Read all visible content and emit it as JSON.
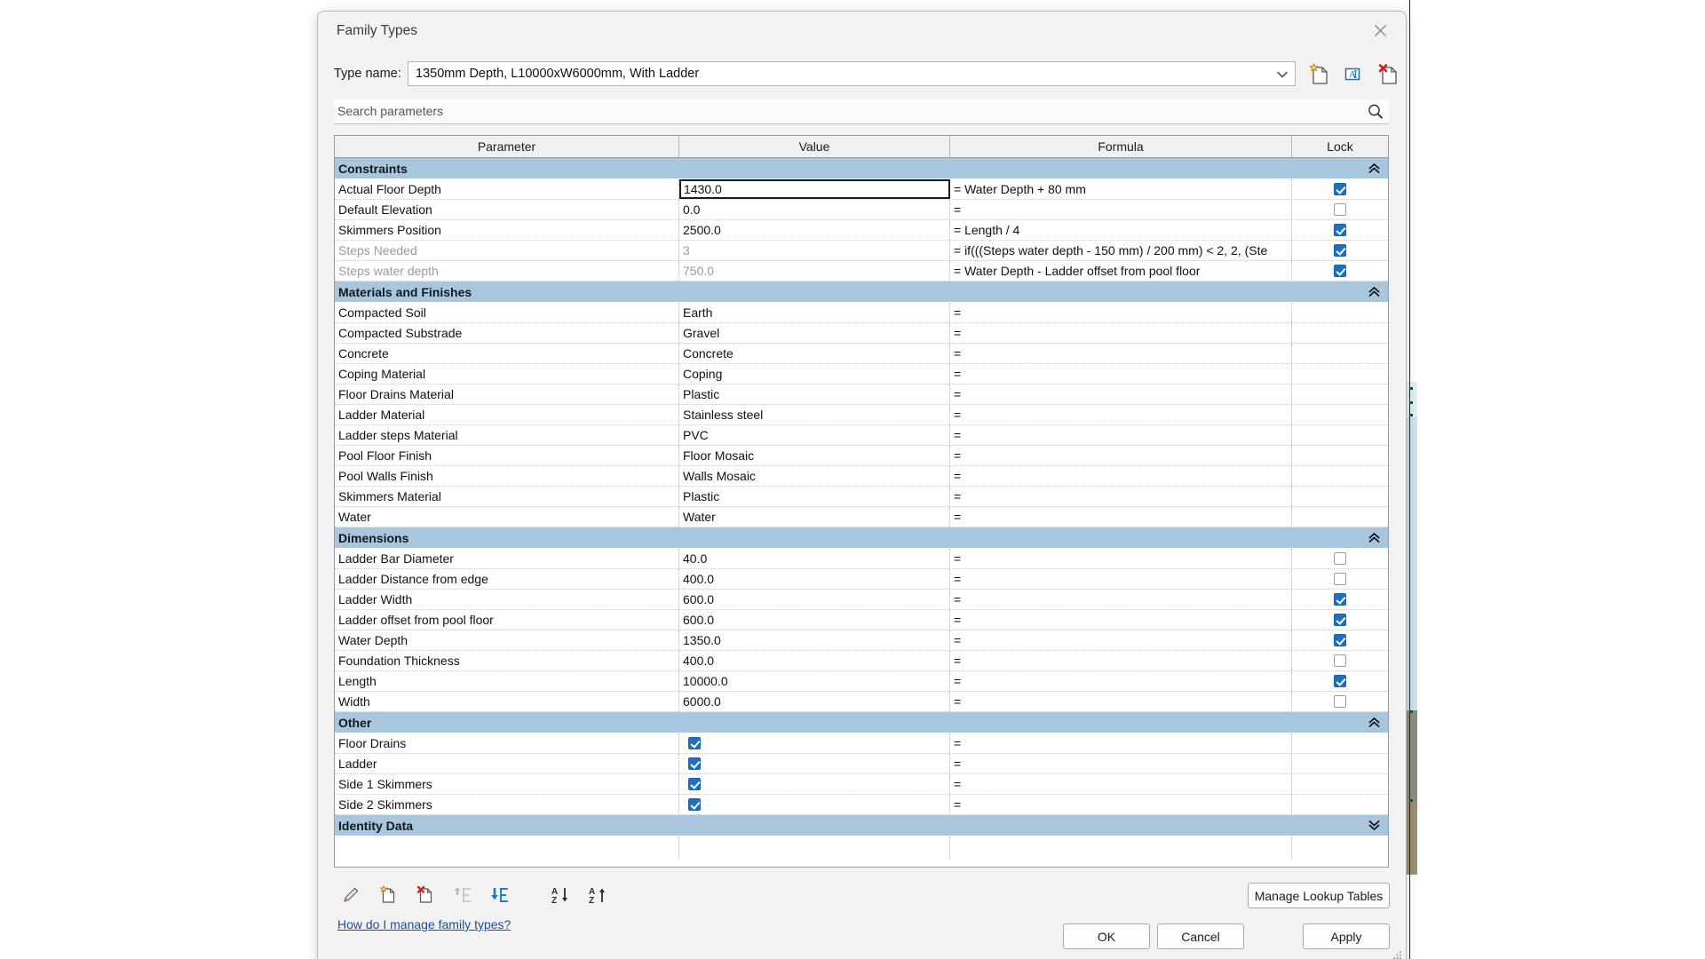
{
  "window": {
    "title": "Family Types",
    "close_icon": "close-icon"
  },
  "type_name": {
    "label": "Type name:",
    "value": "1350mm Depth, L10000xW6000mm, With Ladder",
    "dropdown_icon": "chevron-down-icon",
    "actions": [
      {
        "name": "new-type-icon",
        "tooltip": "New Type"
      },
      {
        "name": "rename-type-icon",
        "tooltip": "Rename"
      },
      {
        "name": "delete-type-icon",
        "tooltip": "Delete"
      }
    ]
  },
  "search": {
    "placeholder": "Search parameters",
    "value": "",
    "icon": "search-icon"
  },
  "table": {
    "headers": {
      "parameter": "Parameter",
      "value": "Value",
      "formula": "Formula",
      "lock": "Lock"
    },
    "groups": [
      {
        "title": "Constraints",
        "collapsed": false,
        "rows": [
          {
            "parameter": "Actual Floor Depth",
            "value": "1430.0",
            "formula": "= Water Depth + 80 mm",
            "lock": "on",
            "disabled": false,
            "editing": true
          },
          {
            "parameter": "Default Elevation",
            "value": "0.0",
            "formula": "=",
            "lock": "off",
            "disabled": false,
            "editing": false
          },
          {
            "parameter": "Skimmers Position",
            "value": "2500.0",
            "formula": "= Length / 4",
            "lock": "on",
            "disabled": false,
            "editing": false
          },
          {
            "parameter": "Steps Needed",
            "value": "3",
            "formula": "= if(((Steps water depth - 150 mm) / 200 mm) < 2, 2, (Ste",
            "lock": "on",
            "disabled": true,
            "editing": false
          },
          {
            "parameter": "Steps water depth",
            "value": "750.0",
            "formula": "= Water Depth - Ladder offset from pool floor",
            "lock": "on",
            "disabled": true,
            "editing": false
          }
        ]
      },
      {
        "title": "Materials and Finishes",
        "collapsed": false,
        "rows": [
          {
            "parameter": "Compacted Soil",
            "value": "Earth",
            "formula": "=",
            "lock": "none",
            "disabled": false,
            "editing": false
          },
          {
            "parameter": "Compacted Substrade",
            "value": "Gravel",
            "formula": "=",
            "lock": "none",
            "disabled": false,
            "editing": false
          },
          {
            "parameter": "Concrete",
            "value": "Concrete",
            "formula": "=",
            "lock": "none",
            "disabled": false,
            "editing": false
          },
          {
            "parameter": "Coping Material",
            "value": "Coping",
            "formula": "=",
            "lock": "none",
            "disabled": false,
            "editing": false
          },
          {
            "parameter": "Floor Drains Material",
            "value": "Plastic",
            "formula": "=",
            "lock": "none",
            "disabled": false,
            "editing": false
          },
          {
            "parameter": "Ladder Material",
            "value": "Stainless steel",
            "formula": "=",
            "lock": "none",
            "disabled": false,
            "editing": false
          },
          {
            "parameter": "Ladder steps Material",
            "value": "PVC",
            "formula": "=",
            "lock": "none",
            "disabled": false,
            "editing": false
          },
          {
            "parameter": "Pool Floor Finish",
            "value": "Floor Mosaic",
            "formula": "=",
            "lock": "none",
            "disabled": false,
            "editing": false
          },
          {
            "parameter": "Pool Walls Finish",
            "value": "Walls Mosaic",
            "formula": "=",
            "lock": "none",
            "disabled": false,
            "editing": false
          },
          {
            "parameter": "Skimmers Material",
            "value": "Plastic",
            "formula": "=",
            "lock": "none",
            "disabled": false,
            "editing": false
          },
          {
            "parameter": "Water",
            "value": "Water",
            "formula": "=",
            "lock": "none",
            "disabled": false,
            "editing": false
          }
        ]
      },
      {
        "title": "Dimensions",
        "collapsed": false,
        "rows": [
          {
            "parameter": "Ladder Bar Diameter",
            "value": "40.0",
            "formula": "=",
            "lock": "off",
            "disabled": false,
            "editing": false
          },
          {
            "parameter": "Ladder Distance from edge",
            "value": "400.0",
            "formula": "=",
            "lock": "off",
            "disabled": false,
            "editing": false
          },
          {
            "parameter": "Ladder Width",
            "value": "600.0",
            "formula": "=",
            "lock": "on",
            "disabled": false,
            "editing": false
          },
          {
            "parameter": "Ladder offset from pool floor",
            "value": "600.0",
            "formula": "=",
            "lock": "on",
            "disabled": false,
            "editing": false
          },
          {
            "parameter": "Water Depth",
            "value": "1350.0",
            "formula": "=",
            "lock": "on",
            "disabled": false,
            "editing": false
          },
          {
            "parameter": "Foundation Thickness",
            "value": "400.0",
            "formula": "=",
            "lock": "off",
            "disabled": false,
            "editing": false
          },
          {
            "parameter": "Length",
            "value": "10000.0",
            "formula": "=",
            "lock": "on",
            "disabled": false,
            "editing": false
          },
          {
            "parameter": "Width",
            "value": "6000.0",
            "formula": "=",
            "lock": "off",
            "disabled": false,
            "editing": false
          }
        ]
      },
      {
        "title": "Other",
        "collapsed": false,
        "rows": [
          {
            "parameter": "Floor Drains",
            "value_checkbox": "on",
            "formula": "=",
            "lock": "none",
            "disabled": false,
            "editing": false
          },
          {
            "parameter": "Ladder",
            "value_checkbox": "on",
            "formula": "=",
            "lock": "none",
            "disabled": false,
            "editing": false
          },
          {
            "parameter": "Side 1 Skimmers",
            "value_checkbox": "on",
            "formula": "=",
            "lock": "none",
            "disabled": false,
            "editing": false
          },
          {
            "parameter": "Side 2 Skimmers",
            "value_checkbox": "on",
            "formula": "=",
            "lock": "none",
            "disabled": false,
            "editing": false
          }
        ]
      },
      {
        "title": "Identity Data",
        "collapsed": true,
        "rows": []
      }
    ]
  },
  "toolbar": {
    "buttons": [
      {
        "name": "edit-parameter-icon",
        "label": "Edit Parameter"
      },
      {
        "name": "new-parameter-icon",
        "label": "New Parameter"
      },
      {
        "name": "remove-parameter-icon",
        "label": "Remove Parameter"
      },
      {
        "name": "move-up-icon",
        "label": "Move Up",
        "enabled": false
      },
      {
        "name": "move-down-icon",
        "label": "Move Down",
        "enabled": true
      },
      {
        "name": "sort-descending-icon",
        "label": "Sort Descending"
      },
      {
        "name": "sort-ascending-icon",
        "label": "Sort Ascending"
      }
    ]
  },
  "footer": {
    "help_link": "How do I manage family types?",
    "manage_lookup_tables": "Manage Lookup Tables",
    "ok": "OK",
    "cancel": "Cancel",
    "apply": "Apply"
  },
  "colors": {
    "group_header": "#a8c6de",
    "checkbox_on": "#1d6fc0",
    "link": "#1a4f9c",
    "dialog_bg": "#f2f2f2"
  }
}
